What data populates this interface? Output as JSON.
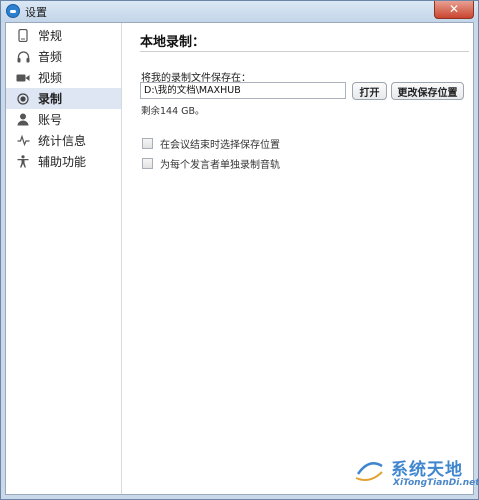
{
  "window": {
    "title": "设置",
    "close_glyph": "✕"
  },
  "sidebar": {
    "items": [
      {
        "label": "常规",
        "icon": "phone-icon"
      },
      {
        "label": "音频",
        "icon": "headphones-icon"
      },
      {
        "label": "视频",
        "icon": "video-camera-icon"
      },
      {
        "label": "录制",
        "icon": "record-icon",
        "active": true
      },
      {
        "label": "账号",
        "icon": "user-icon"
      },
      {
        "label": "统计信息",
        "icon": "pulse-icon"
      },
      {
        "label": "辅助功能",
        "icon": "accessibility-icon"
      }
    ]
  },
  "main": {
    "section_title": "本地录制：",
    "save_label": "将我的录制文件保存在：",
    "path_value": "D:\\我的文档\\MAXHUB",
    "open_button": "打开",
    "change_button": "更改保存位置",
    "remaining": "剩余144 GB。",
    "options": [
      {
        "label": "在会议结束时选择保存位置",
        "checked": false
      },
      {
        "label": "为每个发言者单独录制音轨",
        "checked": false
      }
    ]
  },
  "watermark": {
    "text": "系统天地",
    "sub": "XiTongTianDi.net"
  },
  "colors": {
    "active_nav": "#dfe6f3",
    "titlebar": "#c3d5e9",
    "close": "#c9452f",
    "watermark": "#3f86cf"
  }
}
